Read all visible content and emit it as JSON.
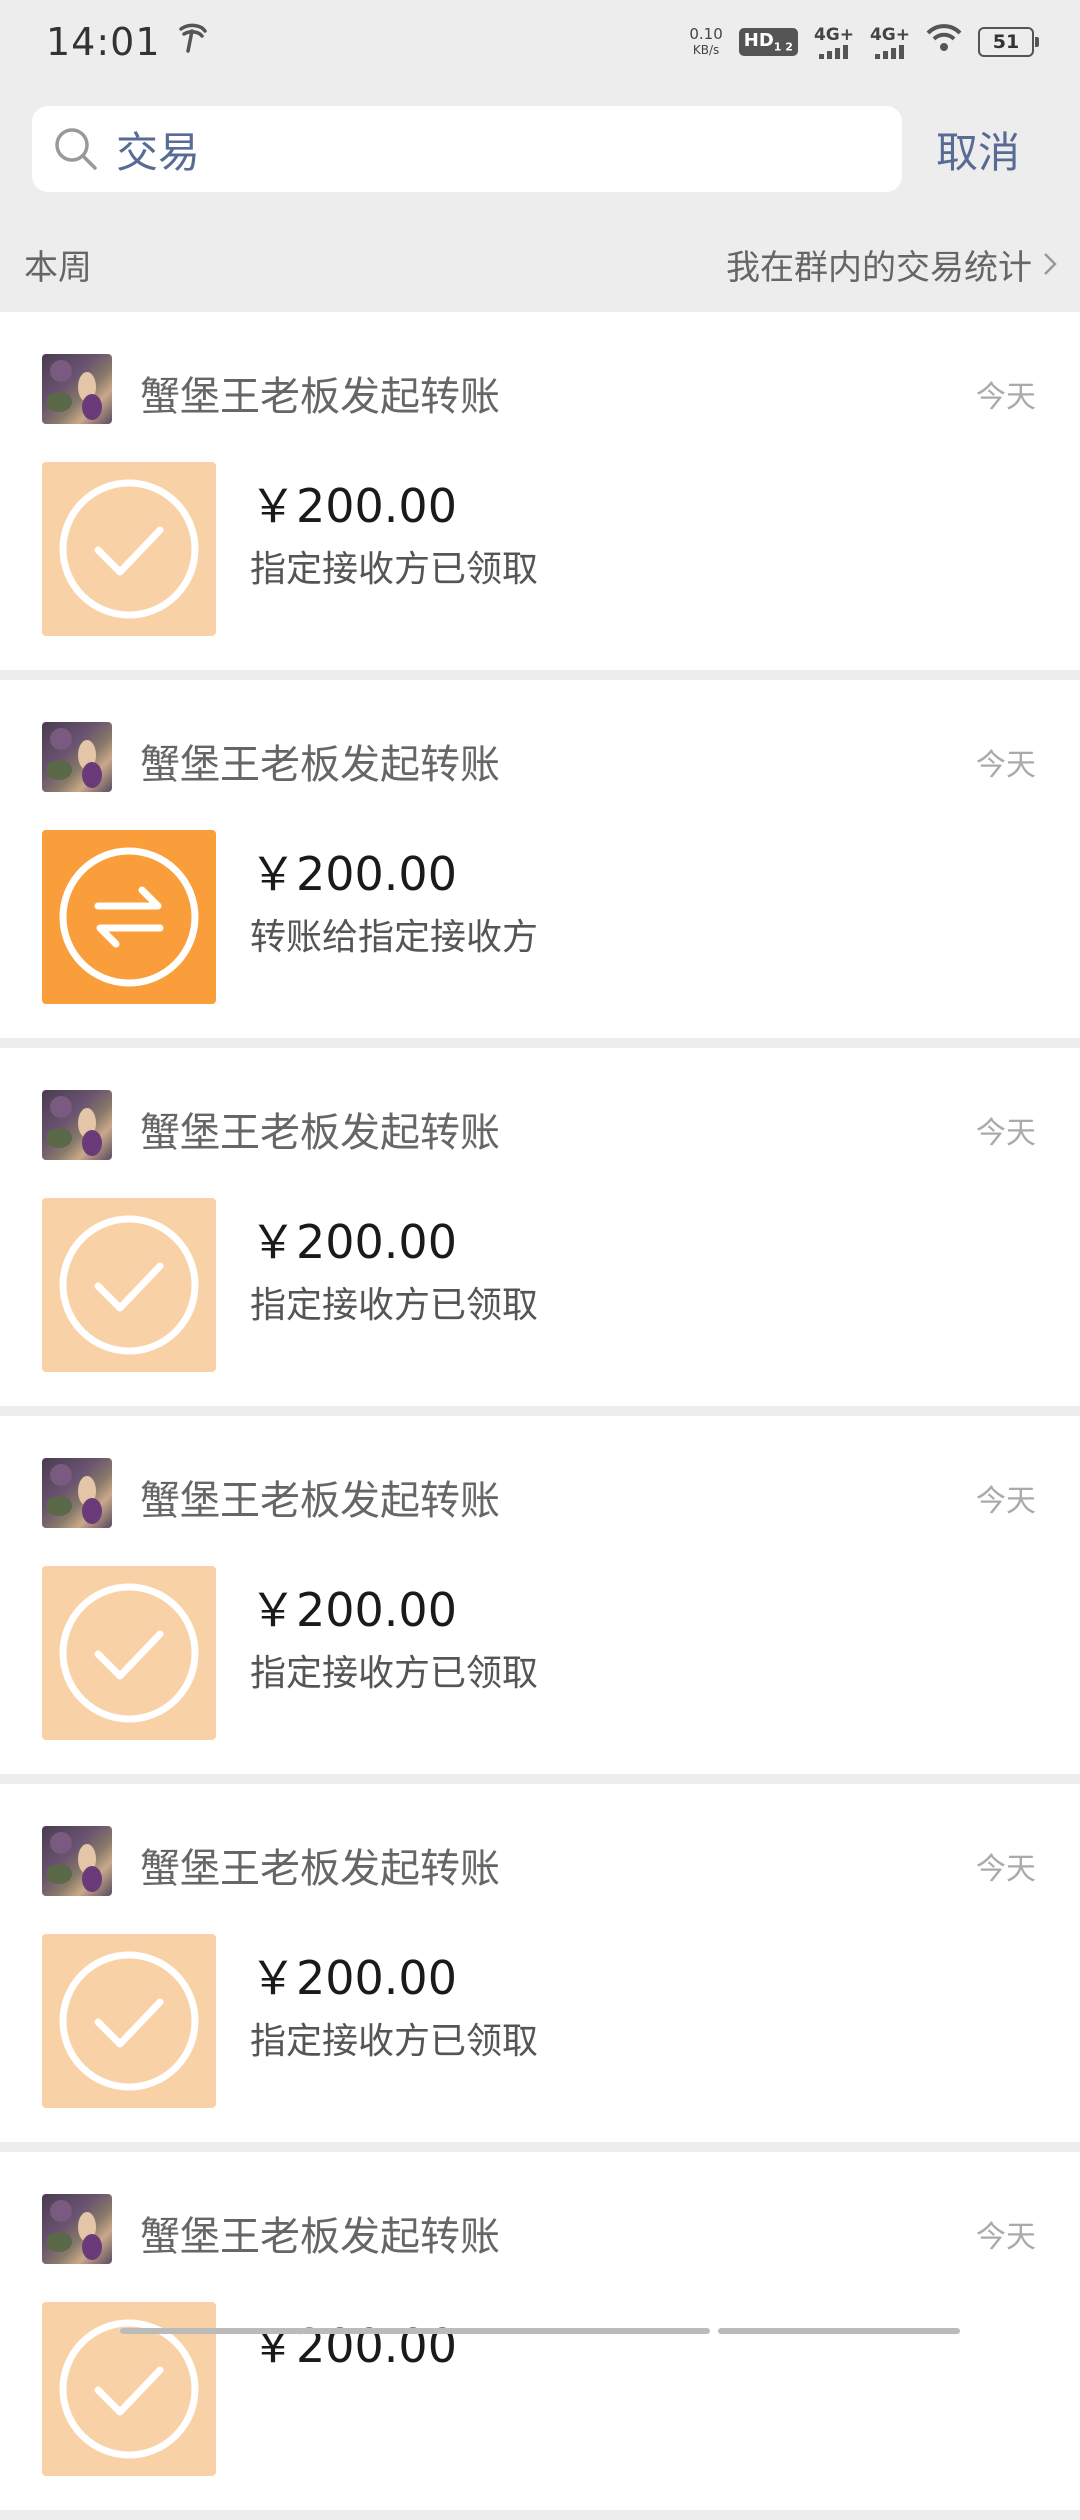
{
  "status_bar": {
    "time": "14:01",
    "carrier_icon": "telecom-icon",
    "net_speed_value": "0.10",
    "net_speed_unit": "KB/s",
    "hd_label": "HD",
    "hd_sub": "1 2",
    "signal1_label": "4G+",
    "signal2_label": "4G+",
    "battery": "51"
  },
  "search": {
    "value": "交易",
    "cancel_label": "取消"
  },
  "section": {
    "title": "本周",
    "stats_link": "我在群内的交易统计"
  },
  "colors": {
    "link": "#576b95",
    "received_tile": "#f8d2a6",
    "pending_tile": "#fa9d3b"
  },
  "transactions": [
    {
      "title": "蟹堡王老板发起转账",
      "date": "今天",
      "amount": "￥200.00",
      "status": "指定接收方已领取",
      "icon": "check-circle-icon"
    },
    {
      "title": "蟹堡王老板发起转账",
      "date": "今天",
      "amount": "￥200.00",
      "status": "转账给指定接收方",
      "icon": "transfer-arrows-icon"
    },
    {
      "title": "蟹堡王老板发起转账",
      "date": "今天",
      "amount": "￥200.00",
      "status": "指定接收方已领取",
      "icon": "check-circle-icon"
    },
    {
      "title": "蟹堡王老板发起转账",
      "date": "今天",
      "amount": "￥200.00",
      "status": "指定接收方已领取",
      "icon": "check-circle-icon"
    },
    {
      "title": "蟹堡王老板发起转账",
      "date": "今天",
      "amount": "￥200.00",
      "status": "指定接收方已领取",
      "icon": "check-circle-icon"
    },
    {
      "title": "蟹堡王老板发起转账",
      "date": "今天",
      "amount": "￥200.00",
      "status": "",
      "icon": "check-circle-icon"
    }
  ]
}
